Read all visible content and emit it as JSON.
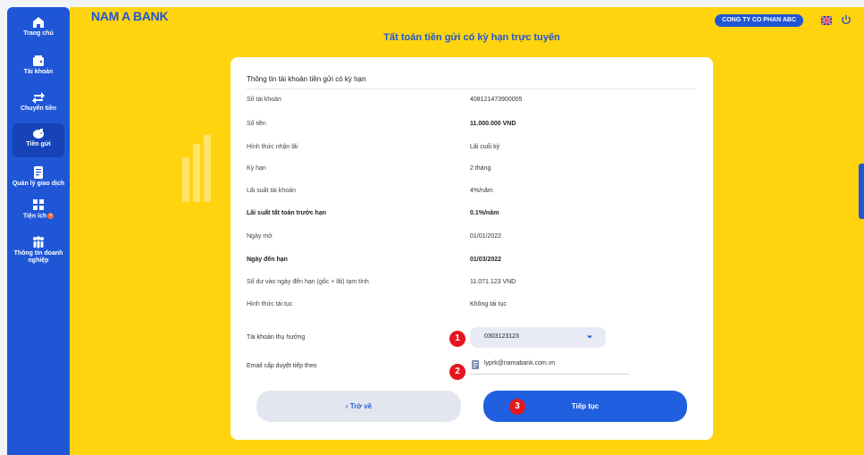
{
  "sidebar": {
    "items": [
      {
        "label": "Trang chủ",
        "icon": "home-icon"
      },
      {
        "label": "Tài khoản",
        "icon": "wallet-icon"
      },
      {
        "label": "Chuyển tiền",
        "icon": "transfer-icon"
      },
      {
        "label": "Tiền gửi",
        "icon": "piggy-bank-icon",
        "active": true
      },
      {
        "label": "Quản lý giao dịch",
        "icon": "transaction-icon"
      },
      {
        "label": "Tiện ích",
        "icon": "grid-icon",
        "badge": "+"
      },
      {
        "label": "Thông tin doanh nghiệp",
        "icon": "people-icon"
      }
    ]
  },
  "header": {
    "logo": "NAM A BANK",
    "title": "Tất toán tiền gửi có kỳ hạn trực tuyến",
    "company": "CONG TY CO PHAN ABC"
  },
  "card": {
    "title": "Thông tin tài khoản tiền gửi có kỳ hạn",
    "rows": [
      {
        "label": "Số tài khoản",
        "value": "408121473900005"
      },
      {
        "label": "Số tiền",
        "value": "11.000.000 VND"
      },
      {
        "label": "Hình thức nhận lãi",
        "value": "Lãi cuối kỳ"
      },
      {
        "label": "Kỳ hạn",
        "value": "2 tháng"
      },
      {
        "label": "Lãi suất tài khoản",
        "value": "4%/năm"
      },
      {
        "label": "Lãi suất tất toán trước hạn",
        "value": "0.1%/năm"
      },
      {
        "label": "Ngày mở",
        "value": "01/01/2022"
      },
      {
        "label": "Ngày đến hạn",
        "value": "01/03/2022"
      },
      {
        "label": "Số dư vào ngày đến hạn (gốc + lãi) tạm tính",
        "value": "11.071.123 VND"
      },
      {
        "label": "Hình thức tái tục",
        "value": "Không tái tục"
      }
    ],
    "beneficiary_label": "Tài khoản thụ hưởng",
    "beneficiary_value": "0303123123",
    "email_label": "Email cấp duyệt tiếp theo",
    "email_value": "lyprk@namabank.com.vn",
    "back_label": "‹  Trở về",
    "next_label": "Tiếp tục",
    "markers": [
      "1",
      "2",
      "3"
    ]
  },
  "colors": {
    "brand_blue": "#1f56d6",
    "brand_yellow": "#ffd40f",
    "marker_red": "#e5161d"
  }
}
